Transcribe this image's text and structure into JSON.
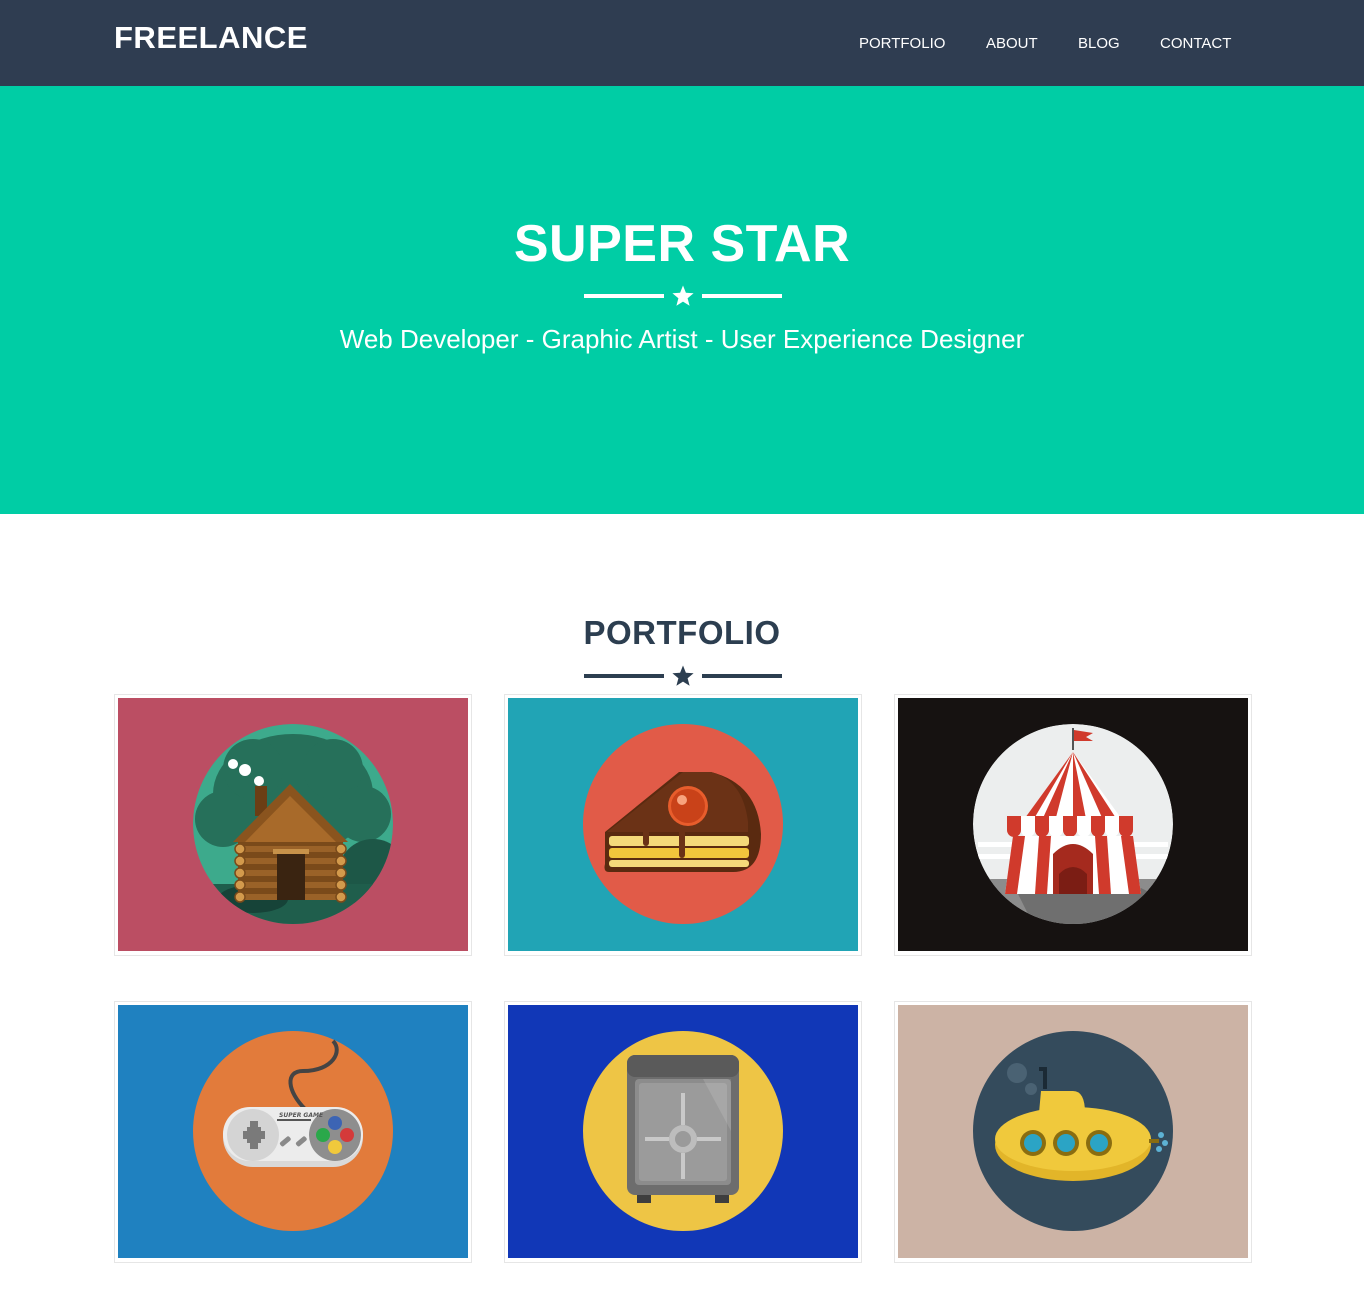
{
  "navbar": {
    "brand": "FREELANCE",
    "links": [
      "PORTFOLIO",
      "ABOUT",
      "BLOG",
      "CONTACT"
    ]
  },
  "hero": {
    "title": "SUPER STAR",
    "divider_icon": "star-icon",
    "subtitle": "Web Developer - Graphic Artist - User Experience Designer"
  },
  "portfolio": {
    "title": "PORTFOLIO",
    "divider_icon": "star-icon",
    "items": [
      {
        "icon": "cabin-icon",
        "bg": "#bb4e63",
        "circle": "#3daa8c"
      },
      {
        "icon": "cake-icon",
        "bg": "#21a4b5",
        "circle": "#e15b48"
      },
      {
        "icon": "circus-tent-icon",
        "bg": "#161211",
        "circle": "#eceeee"
      },
      {
        "icon": "game-controller-icon",
        "bg": "#1f81c0",
        "circle": "#e27b3b"
      },
      {
        "icon": "safe-icon",
        "bg": "#1137b7",
        "circle": "#eec545"
      },
      {
        "icon": "submarine-icon",
        "bg": "#ccb3a5",
        "circle": "#344b5c"
      }
    ],
    "controller_label": "SUPER GAME"
  },
  "colors": {
    "navbar": "#2f3d51",
    "hero": "#00cda5",
    "text_dark": "#2c3e50",
    "white": "#ffffff"
  }
}
